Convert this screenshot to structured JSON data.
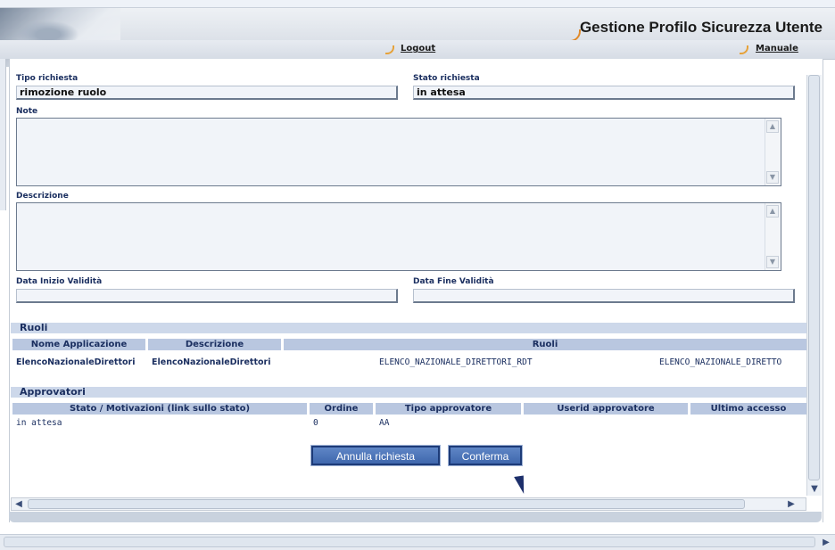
{
  "header": {
    "title": "Gestione Profilo Sicurezza Utente",
    "logout": "Logout",
    "manuale": "Manuale"
  },
  "form": {
    "tipo_label": "Tipo richiesta",
    "tipo_value": "rimozione ruolo",
    "stato_label": "Stato richiesta",
    "stato_value": "in attesa",
    "note_label": "Note",
    "descrizione_label": "Descrizione",
    "data_inizio_label": "Data Inizio Validità",
    "data_fine_label": "Data Fine Validità"
  },
  "ruoli": {
    "title": "Ruoli",
    "headers": [
      "Nome Applicazione",
      "Descrizione",
      "Ruoli"
    ],
    "row": {
      "nome": "ElencoNazionaleDirettori",
      "descrizione": "ElencoNazionaleDirettori",
      "ruolo1": "ELENCO_NAZIONALE_DIRETTORI_RDT",
      "ruolo2": "ELENCO_NAZIONALE_DIRETTO"
    }
  },
  "approvatori": {
    "title": "Approvatori",
    "headers": [
      "Stato / Motivazioni (link sullo stato)",
      "Ordine",
      "Tipo approvatore",
      "Userid approvatore",
      "Ultimo accesso"
    ],
    "row": {
      "stato": "in attesa",
      "ordine": "0",
      "tipo": "AA"
    }
  },
  "buttons": {
    "annulla": "Annulla richiesta",
    "conferma": "Conferma"
  },
  "colors": {
    "accent": "#3f67ad",
    "header_text": "#1b2f60",
    "section_bar": "#cdd8ea"
  }
}
